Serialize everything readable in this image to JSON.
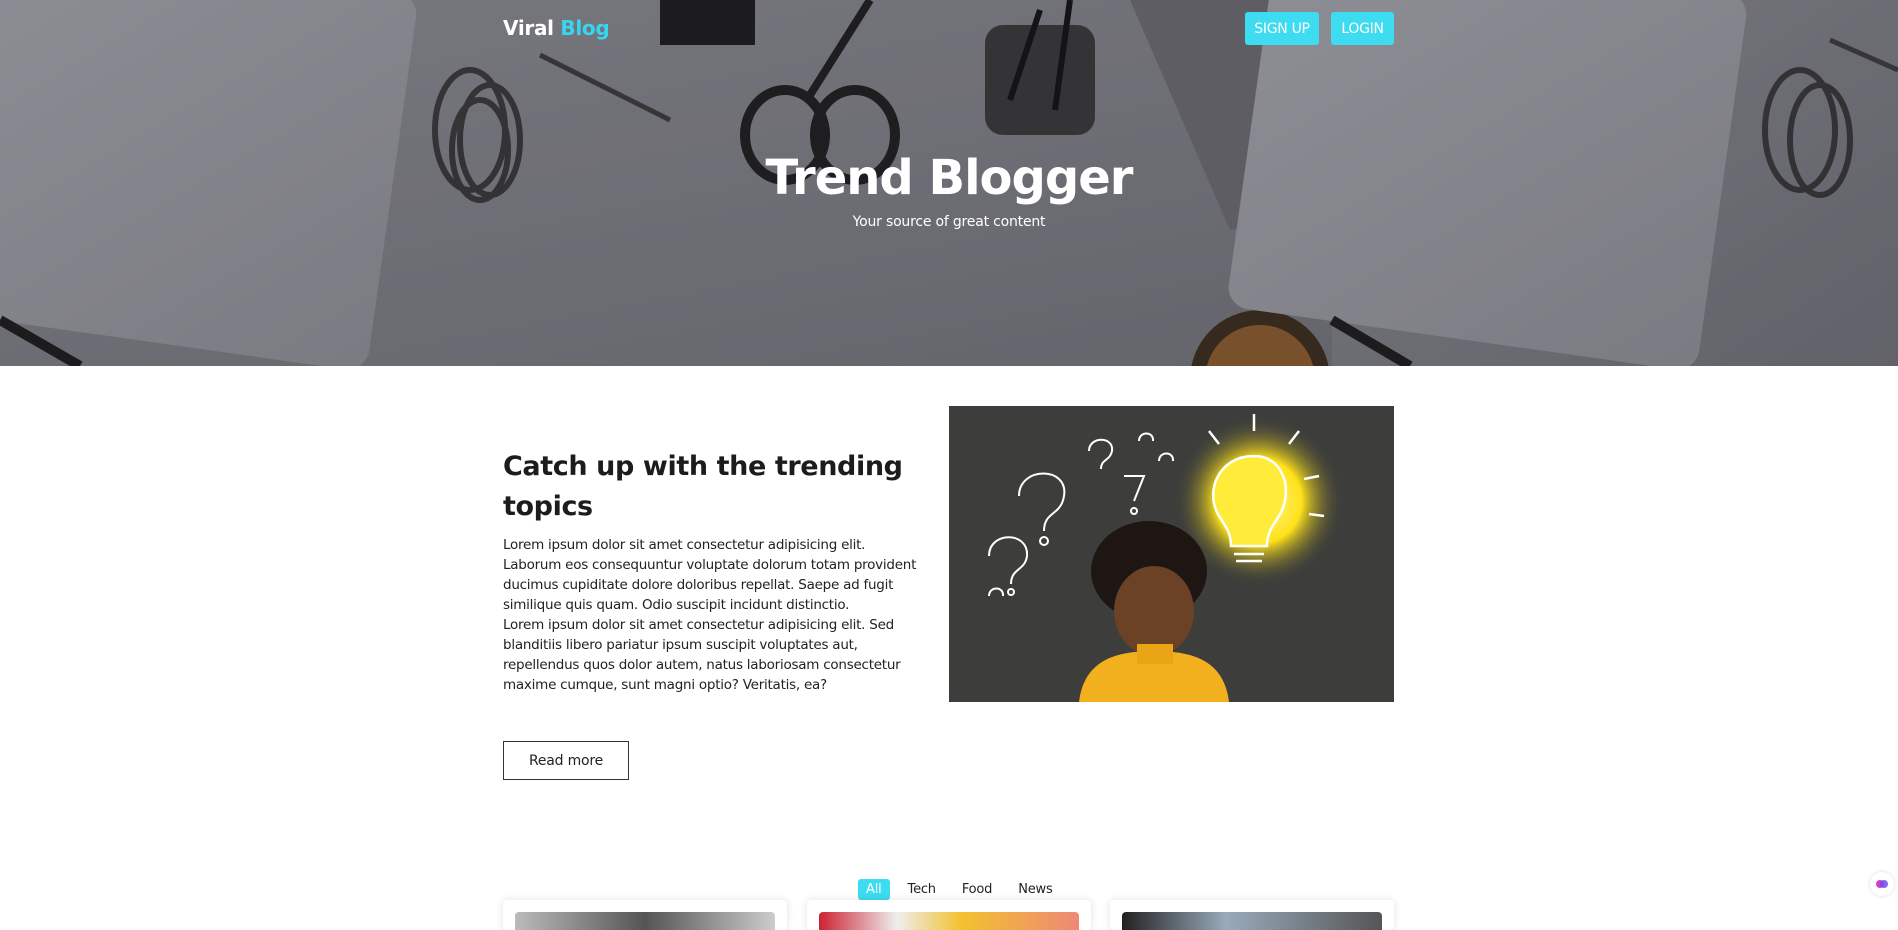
{
  "header": {
    "brand_primary": "Viral",
    "brand_accent": "Blog",
    "signup_label": "SIGN UP",
    "login_label": "LOGIN"
  },
  "hero": {
    "title": "Trend Blogger",
    "subtitle": "Your source of great content"
  },
  "feature": {
    "title": "Catch up with the trending topics",
    "paragraph_1": "Lorem ipsum dolor sit amet consectetur adipisicing elit. Laborum eos consequuntur voluptate dolorum totam provident ducimus cupiditate dolore doloribus repellat. Saepe ad fugit similique quis quam. Odio suscipit incidunt distinctio.",
    "paragraph_2": "Lorem ipsum dolor sit amet consectetur adipisicing elit. Sed blanditiis libero pariatur ipsum suscipit voluptates aut, repellendus quos dolor autem, natus laboriosam consectetur maxime cumque, sunt magni optio? Veritatis, ea?",
    "read_more_label": "Read more",
    "image_icon": "child-lightbulb-illustration"
  },
  "filters": {
    "tabs": [
      {
        "label": "All",
        "active": true
      },
      {
        "label": "Tech",
        "active": false
      },
      {
        "label": "Food",
        "active": false
      },
      {
        "label": "News",
        "active": false
      }
    ]
  },
  "colors": {
    "accent": "#3ddcf1",
    "text": "#1c1c1c",
    "hero_bg": "#7d7d83"
  }
}
